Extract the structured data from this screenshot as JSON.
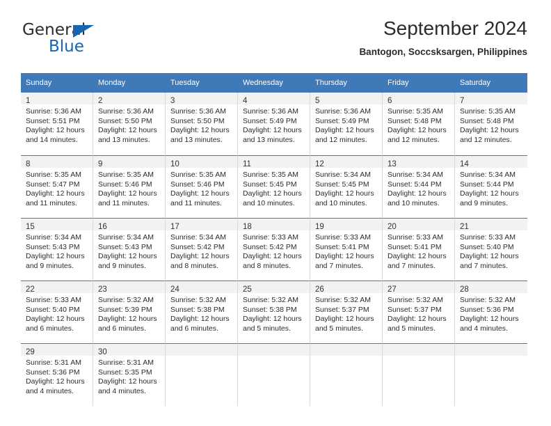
{
  "brand": {
    "name_top": "General",
    "name_bottom": "Blue",
    "triangle_icon": "brand-triangle-icon",
    "color_dark": "#2b2b2b",
    "color_blue": "#1666b0"
  },
  "header": {
    "title": "September 2024",
    "subtitle": "Bantogon, Soccsksargen, Philippines"
  },
  "theme": {
    "header_blue": "#3f79b8",
    "daynum_band": "#f2f2f2",
    "grid_line": "#d9d9d9",
    "text": "#2b2b2b"
  },
  "calendar": {
    "weekday_headers": [
      "Sunday",
      "Monday",
      "Tuesday",
      "Wednesday",
      "Thursday",
      "Friday",
      "Saturday"
    ],
    "labels": {
      "sunrise": "Sunrise:",
      "sunset": "Sunset:",
      "daylight": "Daylight:"
    },
    "weeks": [
      [
        {
          "day": "1",
          "sunrise": "Sunrise: 5:36 AM",
          "sunset": "Sunset: 5:51 PM",
          "daylight_1": "Daylight: 12 hours",
          "daylight_2": "and 14 minutes."
        },
        {
          "day": "2",
          "sunrise": "Sunrise: 5:36 AM",
          "sunset": "Sunset: 5:50 PM",
          "daylight_1": "Daylight: 12 hours",
          "daylight_2": "and 13 minutes."
        },
        {
          "day": "3",
          "sunrise": "Sunrise: 5:36 AM",
          "sunset": "Sunset: 5:50 PM",
          "daylight_1": "Daylight: 12 hours",
          "daylight_2": "and 13 minutes."
        },
        {
          "day": "4",
          "sunrise": "Sunrise: 5:36 AM",
          "sunset": "Sunset: 5:49 PM",
          "daylight_1": "Daylight: 12 hours",
          "daylight_2": "and 13 minutes."
        },
        {
          "day": "5",
          "sunrise": "Sunrise: 5:36 AM",
          "sunset": "Sunset: 5:49 PM",
          "daylight_1": "Daylight: 12 hours",
          "daylight_2": "and 12 minutes."
        },
        {
          "day": "6",
          "sunrise": "Sunrise: 5:35 AM",
          "sunset": "Sunset: 5:48 PM",
          "daylight_1": "Daylight: 12 hours",
          "daylight_2": "and 12 minutes."
        },
        {
          "day": "7",
          "sunrise": "Sunrise: 5:35 AM",
          "sunset": "Sunset: 5:48 PM",
          "daylight_1": "Daylight: 12 hours",
          "daylight_2": "and 12 minutes."
        }
      ],
      [
        {
          "day": "8",
          "sunrise": "Sunrise: 5:35 AM",
          "sunset": "Sunset: 5:47 PM",
          "daylight_1": "Daylight: 12 hours",
          "daylight_2": "and 11 minutes."
        },
        {
          "day": "9",
          "sunrise": "Sunrise: 5:35 AM",
          "sunset": "Sunset: 5:46 PM",
          "daylight_1": "Daylight: 12 hours",
          "daylight_2": "and 11 minutes."
        },
        {
          "day": "10",
          "sunrise": "Sunrise: 5:35 AM",
          "sunset": "Sunset: 5:46 PM",
          "daylight_1": "Daylight: 12 hours",
          "daylight_2": "and 11 minutes."
        },
        {
          "day": "11",
          "sunrise": "Sunrise: 5:35 AM",
          "sunset": "Sunset: 5:45 PM",
          "daylight_1": "Daylight: 12 hours",
          "daylight_2": "and 10 minutes."
        },
        {
          "day": "12",
          "sunrise": "Sunrise: 5:34 AM",
          "sunset": "Sunset: 5:45 PM",
          "daylight_1": "Daylight: 12 hours",
          "daylight_2": "and 10 minutes."
        },
        {
          "day": "13",
          "sunrise": "Sunrise: 5:34 AM",
          "sunset": "Sunset: 5:44 PM",
          "daylight_1": "Daylight: 12 hours",
          "daylight_2": "and 10 minutes."
        },
        {
          "day": "14",
          "sunrise": "Sunrise: 5:34 AM",
          "sunset": "Sunset: 5:44 PM",
          "daylight_1": "Daylight: 12 hours",
          "daylight_2": "and 9 minutes."
        }
      ],
      [
        {
          "day": "15",
          "sunrise": "Sunrise: 5:34 AM",
          "sunset": "Sunset: 5:43 PM",
          "daylight_1": "Daylight: 12 hours",
          "daylight_2": "and 9 minutes."
        },
        {
          "day": "16",
          "sunrise": "Sunrise: 5:34 AM",
          "sunset": "Sunset: 5:43 PM",
          "daylight_1": "Daylight: 12 hours",
          "daylight_2": "and 9 minutes."
        },
        {
          "day": "17",
          "sunrise": "Sunrise: 5:34 AM",
          "sunset": "Sunset: 5:42 PM",
          "daylight_1": "Daylight: 12 hours",
          "daylight_2": "and 8 minutes."
        },
        {
          "day": "18",
          "sunrise": "Sunrise: 5:33 AM",
          "sunset": "Sunset: 5:42 PM",
          "daylight_1": "Daylight: 12 hours",
          "daylight_2": "and 8 minutes."
        },
        {
          "day": "19",
          "sunrise": "Sunrise: 5:33 AM",
          "sunset": "Sunset: 5:41 PM",
          "daylight_1": "Daylight: 12 hours",
          "daylight_2": "and 7 minutes."
        },
        {
          "day": "20",
          "sunrise": "Sunrise: 5:33 AM",
          "sunset": "Sunset: 5:41 PM",
          "daylight_1": "Daylight: 12 hours",
          "daylight_2": "and 7 minutes."
        },
        {
          "day": "21",
          "sunrise": "Sunrise: 5:33 AM",
          "sunset": "Sunset: 5:40 PM",
          "daylight_1": "Daylight: 12 hours",
          "daylight_2": "and 7 minutes."
        }
      ],
      [
        {
          "day": "22",
          "sunrise": "Sunrise: 5:33 AM",
          "sunset": "Sunset: 5:40 PM",
          "daylight_1": "Daylight: 12 hours",
          "daylight_2": "and 6 minutes."
        },
        {
          "day": "23",
          "sunrise": "Sunrise: 5:32 AM",
          "sunset": "Sunset: 5:39 PM",
          "daylight_1": "Daylight: 12 hours",
          "daylight_2": "and 6 minutes."
        },
        {
          "day": "24",
          "sunrise": "Sunrise: 5:32 AM",
          "sunset": "Sunset: 5:38 PM",
          "daylight_1": "Daylight: 12 hours",
          "daylight_2": "and 6 minutes."
        },
        {
          "day": "25",
          "sunrise": "Sunrise: 5:32 AM",
          "sunset": "Sunset: 5:38 PM",
          "daylight_1": "Daylight: 12 hours",
          "daylight_2": "and 5 minutes."
        },
        {
          "day": "26",
          "sunrise": "Sunrise: 5:32 AM",
          "sunset": "Sunset: 5:37 PM",
          "daylight_1": "Daylight: 12 hours",
          "daylight_2": "and 5 minutes."
        },
        {
          "day": "27",
          "sunrise": "Sunrise: 5:32 AM",
          "sunset": "Sunset: 5:37 PM",
          "daylight_1": "Daylight: 12 hours",
          "daylight_2": "and 5 minutes."
        },
        {
          "day": "28",
          "sunrise": "Sunrise: 5:32 AM",
          "sunset": "Sunset: 5:36 PM",
          "daylight_1": "Daylight: 12 hours",
          "daylight_2": "and 4 minutes."
        }
      ],
      [
        {
          "day": "29",
          "sunrise": "Sunrise: 5:31 AM",
          "sunset": "Sunset: 5:36 PM",
          "daylight_1": "Daylight: 12 hours",
          "daylight_2": "and 4 minutes."
        },
        {
          "day": "30",
          "sunrise": "Sunrise: 5:31 AM",
          "sunset": "Sunset: 5:35 PM",
          "daylight_1": "Daylight: 12 hours",
          "daylight_2": "and 4 minutes."
        },
        {
          "day": "",
          "sunrise": "",
          "sunset": "",
          "daylight_1": "",
          "daylight_2": ""
        },
        {
          "day": "",
          "sunrise": "",
          "sunset": "",
          "daylight_1": "",
          "daylight_2": ""
        },
        {
          "day": "",
          "sunrise": "",
          "sunset": "",
          "daylight_1": "",
          "daylight_2": ""
        },
        {
          "day": "",
          "sunrise": "",
          "sunset": "",
          "daylight_1": "",
          "daylight_2": ""
        },
        {
          "day": "",
          "sunrise": "",
          "sunset": "",
          "daylight_1": "",
          "daylight_2": ""
        }
      ]
    ]
  }
}
